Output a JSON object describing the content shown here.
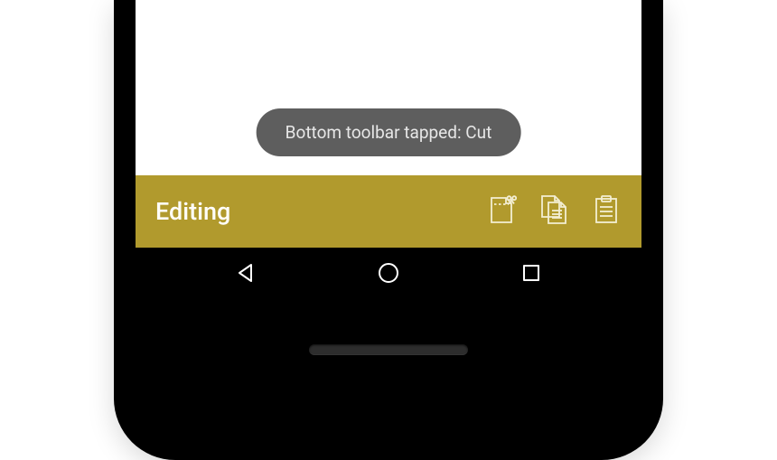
{
  "toast": {
    "message": "Bottom toolbar tapped: Cut"
  },
  "toolbar": {
    "title": "Editing",
    "icons": {
      "cut": "cut-icon",
      "copy": "copy-icon",
      "paste": "paste-icon"
    }
  }
}
